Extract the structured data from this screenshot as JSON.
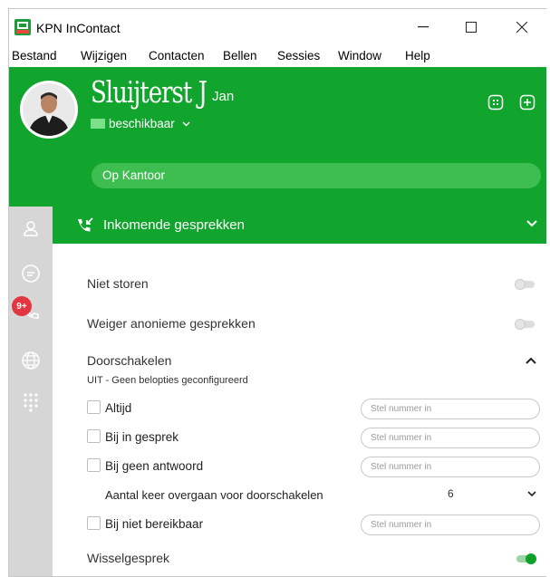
{
  "window": {
    "title": "KPN InContact",
    "minimize_glyph": "—",
    "maximize_glyph": "☐",
    "close_glyph": "✕"
  },
  "menu": [
    "Bestand",
    "Wijzigen",
    "Contacten",
    "Bellen",
    "Sessies",
    "Window",
    "Help"
  ],
  "profile": {
    "name_signature": "Sluijterst J",
    "name": "Jan",
    "status": "beschikbaar",
    "location": "Op Kantoor"
  },
  "section": {
    "title": "Inkomende gesprekken"
  },
  "settings": {
    "dnd_label": "Niet storen",
    "dnd_on": false,
    "anon_label": "Weiger anonieme gesprekken",
    "anon_on": false,
    "forward_label": "Doorschakelen",
    "forward_sub": "UIT - Geen belopties geconfigureerd",
    "options": [
      {
        "label": "Altijd",
        "placeholder": "Stel nummer in"
      },
      {
        "label": "Bij in gesprek",
        "placeholder": "Stel nummer in"
      },
      {
        "label": "Bij geen antwoord",
        "placeholder": "Stel nummer in"
      }
    ],
    "rings_label": "Aantal keer overgaan voor doorschakelen",
    "rings_value": "6",
    "unreachable": {
      "label": "Bij niet bereikbaar",
      "placeholder": "Stel nummer in"
    },
    "call_waiting_label": "Wisselgesprek",
    "call_waiting_on": true
  },
  "rail": {
    "badge": "9+",
    "icons": [
      "person-icon",
      "chat-icon",
      "phone-history-icon",
      "globe-icon",
      "dialpad-icon"
    ]
  },
  "colors": {
    "brand_green": "#12a52e",
    "toggle_on": "#0fa02a",
    "badge_red": "#e2353f"
  }
}
